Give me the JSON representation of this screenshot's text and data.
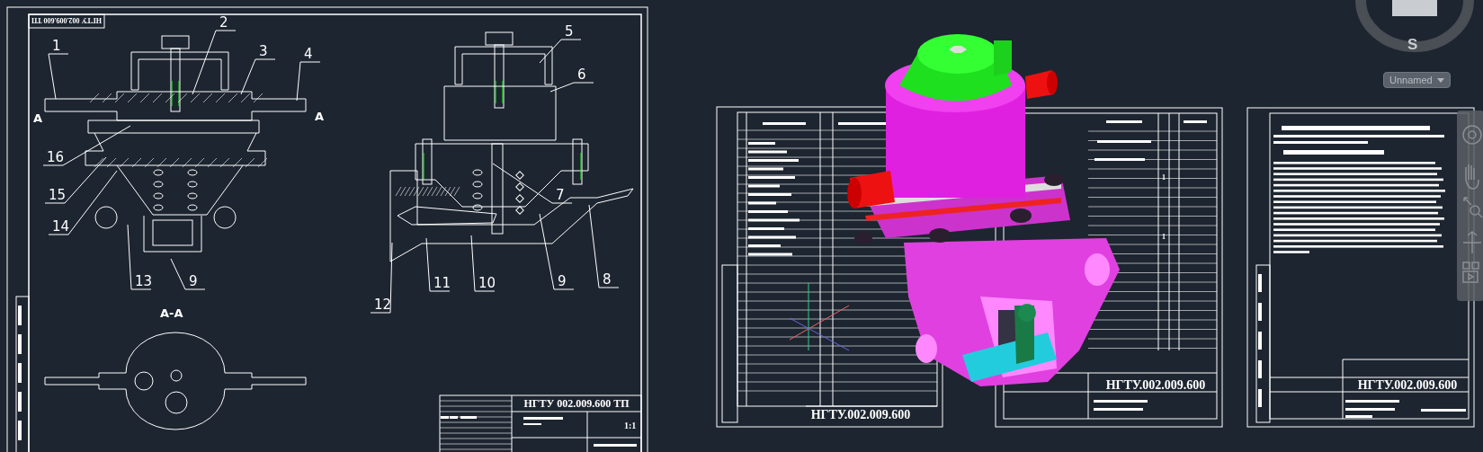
{
  "left_sheet": {
    "stamp": "НГТУ 002.009.600 ТП",
    "callouts": [
      "1",
      "2",
      "3",
      "4",
      "5",
      "6",
      "16",
      "15",
      "14",
      "7",
      "13",
      "9",
      "11",
      "10",
      "9",
      "8",
      "12"
    ],
    "section_marks": [
      "A",
      "A"
    ],
    "section_title": "А-А",
    "title_block": {
      "number": "НГТУ 002.009.600 ТП",
      "scale": "1:1"
    }
  },
  "spec_sheet": {
    "number": "НГТУ.002.009.600"
  },
  "list_sheet": {
    "number": "НГТУ.002.009.600",
    "quantities": [
      "1",
      "1"
    ]
  },
  "text_sheet": {
    "number": "НГТУ.002.009.600"
  },
  "viewcube": {
    "compass": "S"
  },
  "view_menu": {
    "label": "Unnamed"
  }
}
